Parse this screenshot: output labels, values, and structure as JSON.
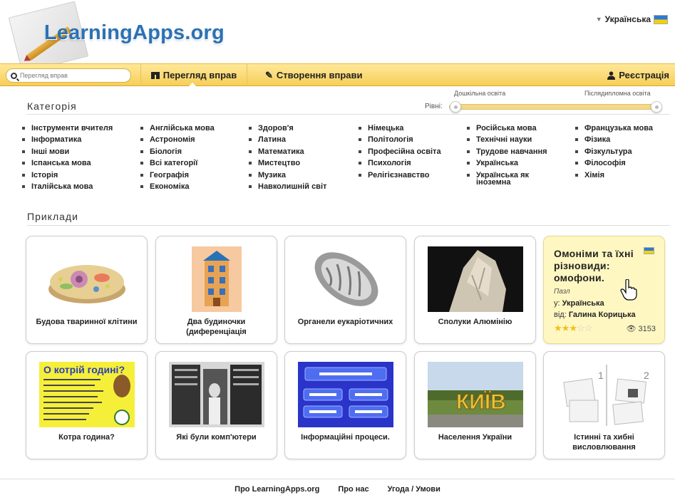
{
  "header": {
    "logo_text": "LearningApps.org",
    "language": "Українська",
    "search_placeholder": "Перегляд вправ",
    "nav_browse": "Перегляд вправ",
    "nav_create": "Створення вправи",
    "nav_register": "Реєстрація"
  },
  "category": {
    "title": "Категорія",
    "levels_label": "Рівні:",
    "level_min": "Дошкільна освіта",
    "level_max": "Післядипломна освіта",
    "columns": [
      [
        "Інструменти вчителя",
        "Інформатика",
        "Інші мови",
        "Іспанська мова",
        "Історія",
        "Італійська мова"
      ],
      [
        "Англійська мова",
        "Астрономія",
        "Біологія",
        "Всі категорії",
        "Географія",
        "Економіка"
      ],
      [
        "Здоров'я",
        "Латина",
        "Математика",
        "Мистецтво",
        "Музика",
        "Навколишній світ"
      ],
      [
        "Німецька",
        "Політологія",
        "Професійна освіта",
        "Психологія",
        "Релігієзнавство"
      ],
      [
        "Російська мова",
        "Технічні науки",
        "Трудове навчання",
        "Українська",
        "Українська як іноземна"
      ],
      [
        "Французька мова",
        "Фізика",
        "Фізкультура",
        "Філософія",
        "Хімія"
      ]
    ]
  },
  "examples": {
    "title": "Приклади",
    "cards": [
      {
        "title": "Будова тваринної клітини",
        "image": "cell-image"
      },
      {
        "title": "Два будиночки (диференціація",
        "image": "house-image"
      },
      {
        "title": "Органели еукаріотичних",
        "image": "mitochondria-image"
      },
      {
        "title": "Сполуки Алюмінію",
        "image": "rock-image"
      },
      {
        "title": "Котра година?",
        "image": "clock-poster-image",
        "poster_heading": "О котрій годині?"
      },
      {
        "title": "Які були комп'ютери",
        "image": "old-computer-image"
      },
      {
        "title": "Інформаційні процеси.",
        "image": "quiz-image"
      },
      {
        "title": "Населення України",
        "image": "kyiv-sign-image",
        "sign_text": "КИЇВ"
      },
      {
        "title": "Істинні та хибні висловлювання",
        "image": "true-false-image"
      }
    ],
    "highlight": {
      "title": "Омоніми та їхні різновиди: омофони.",
      "type": "Пазл",
      "lang_prefix": "у:",
      "lang": "Українська",
      "author_prefix": "від:",
      "author": "Галина Корицька",
      "rating": 3,
      "views": "3153"
    }
  },
  "footer": {
    "links": [
      "Про LearningApps.org",
      "Про нас",
      "Угода / Умови"
    ]
  },
  "colors": {
    "accent": "#2a72b5",
    "navbar": "#f6cf58",
    "highlight": "#fff7c2"
  }
}
